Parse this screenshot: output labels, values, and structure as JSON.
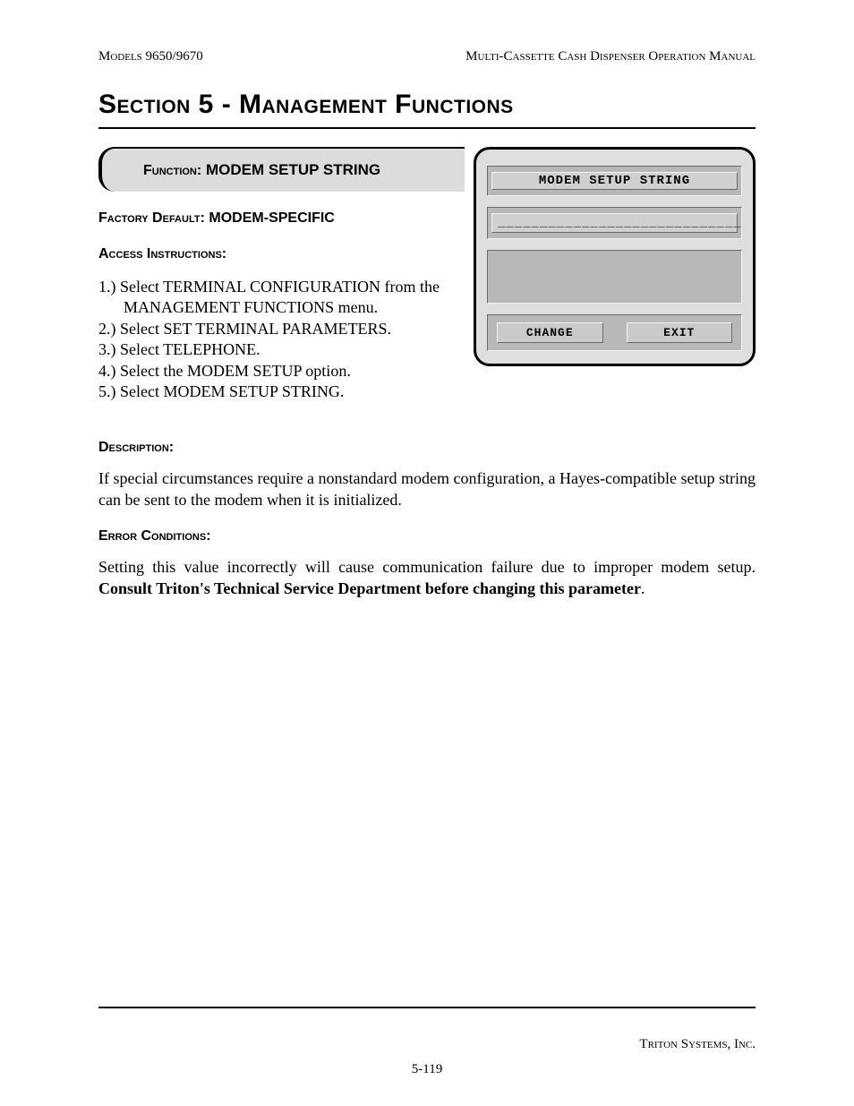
{
  "header": {
    "left": "Models 9650/9670",
    "right": "Multi-Cassette Cash Dispenser Operation Manual"
  },
  "section_title": "Section 5 - Management Functions",
  "function_box": {
    "label": "Function:",
    "name": "MODEM SETUP STRING"
  },
  "factory_default": {
    "label": "Factory Default:",
    "value": "MODEM-SPECIFIC"
  },
  "access_instructions_label": "Access Instructions:",
  "steps": [
    "1.)  Select TERMINAL CONFIGURATION from the MANAGEMENT FUNCTIONS menu.",
    "2.)  Select SET TERMINAL PARAMETERS.",
    "3.)  Select TELEPHONE.",
    "4.)  Select the MODEM SETUP option.",
    "5.)  Select MODEM SETUP STRING."
  ],
  "description_label": "Description:",
  "description_text": "If special circumstances require a nonstandard modem configuration, a Hayes-compatible setup string can be sent to the modem when it is initialized.",
  "error_conditions_label": "Error Conditions:",
  "error_text_plain": "Setting this value incorrectly will cause communication failure due to improper modem setup. ",
  "error_text_bold": "Consult Triton's Technical Service Department before changing this  parameter",
  "error_text_tail": ".",
  "atm": {
    "title": "MODEM SETUP STRING",
    "input_value": "_____________________________",
    "change_button": "CHANGE",
    "exit_button": "EXIT"
  },
  "footer": {
    "company": "Triton Systems, Inc.",
    "page": "5-119"
  }
}
